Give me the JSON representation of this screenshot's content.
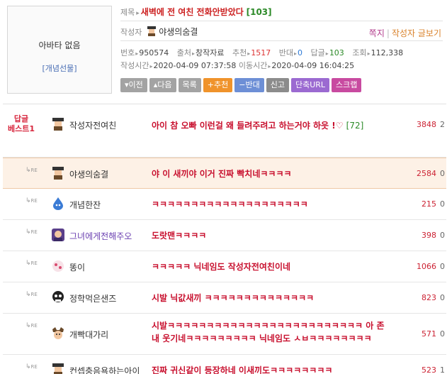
{
  "avatar": {
    "none_label": "아바타 없음",
    "gift_link": "[개념선물]"
  },
  "post": {
    "title_prefix": "제목",
    "title": "새벽에 전 여친 전화안받았다",
    "comment_count": "[103]",
    "author_label": "작성자",
    "author_name": "야생의숨결",
    "link_note": "쪽지",
    "link_sep": "|",
    "link_posts": "작성자 글보기",
    "number_label": "번호",
    "number": "950574",
    "source_label": "출처",
    "source": "창작자료",
    "recommend_label": "추천",
    "recommend": "1517",
    "oppose_label": "반대",
    "oppose": "0",
    "comments_label": "답글",
    "comments": "103",
    "views_label": "조회",
    "views": "112,338",
    "written_label": "작성시간",
    "written": "2020-04-09 07:37:58",
    "moved_label": "이동시간",
    "moved": "2020-04-09 16:04:25"
  },
  "buttons": {
    "prev": "▾이전",
    "next": "▴다음",
    "list": "목록",
    "recommend": "+추천",
    "oppose": "−반대",
    "report": "신고",
    "short_url": "단축URL",
    "scrap": "스크랩"
  },
  "comments": [
    {
      "best_line1": "답글",
      "best_line2": "베스트1",
      "nick": "작성자전여친",
      "text": "아이 참 오빠 이런걸 왜 들려주려고 하는거야 하읏 !♡",
      "count": "[72]",
      "num": "3848",
      "zero": "2"
    },
    {
      "re": "RE",
      "nick": "야생의숨결",
      "text": "야 이 새끼야 이거 진짜 빡치네ㅋㅋㅋㅋ",
      "num": "2584",
      "zero": "0"
    },
    {
      "re": "RE",
      "nick": "개념한잔",
      "text": "ㅋㅋㅋㅋㅋㅋㅋㅋㅋㅋㅋㅋㅋㅋㅋㅋㅋㅋㅋㅋ",
      "num": "215",
      "zero": "0"
    },
    {
      "re": "RE",
      "nick": "그녀에게전해주오",
      "text": "도랏맨ㅋㅋㅋㅋ",
      "num": "398",
      "zero": "0"
    },
    {
      "re": "RE",
      "nick": "똥이",
      "text": "ㅋㅋㅋㅋㅋ 닉네임도 작성자전여친이네",
      "num": "1066",
      "zero": "0"
    },
    {
      "re": "RE",
      "nick": "정학먹은샌즈",
      "text": "시발 닉값새끼 ㅋㅋㅋㅋㅋㅋㅋㅋㅋㅋㅋㅋㅋㅋ",
      "num": "823",
      "zero": "0"
    },
    {
      "re": "RE",
      "nick": "개빡대가리",
      "text_line1": "시발ㅋㅋㅋㅋㅋㅋㅋㅋㅋㅋㅋㅋㅋㅋㅋㅋㅋㅋㅋㅋㅋㅋㅋㅋㅋ 아 존",
      "text_line2": "내 웃기네ㅋㅋㅋㅋㅋㅋㅋㅋㅋ 닉네임도 ㅅㅂㅋㅋㅋㅋㅋㅋㅋㅋ",
      "num": "571",
      "zero": "0"
    },
    {
      "re": "RE",
      "nick": "컨셉충음욕하는아이",
      "text": "진짜 귀신같이 등장하네 이새끼도ㅋㅋㅋㅋㅋㅋㅋㅋ",
      "num": "523",
      "zero": "1"
    }
  ],
  "colors": {
    "accent_red": "#c8102e",
    "green": "#2c8a28",
    "highlight_row": "#fdf1e6"
  },
  "icons": [
    "mini-avatar-icon",
    "re-arrow-icon",
    "water-drop-icon",
    "character-icon",
    "skull-icon"
  ]
}
